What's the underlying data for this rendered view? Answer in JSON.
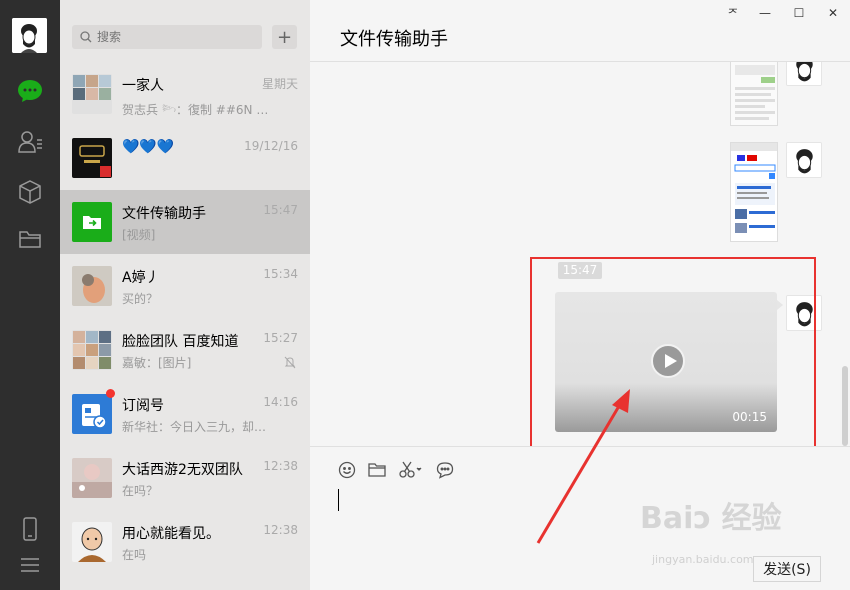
{
  "search": {
    "placeholder": "搜索"
  },
  "add_label": "+",
  "sessions": [
    {
      "name": "一家人",
      "preview": "贺志兵 𓆸：復制 ##6N …",
      "time": "星期天"
    },
    {
      "name": "💙💙💙",
      "preview": "",
      "time": "19/12/16"
    },
    {
      "name": "文件传输助手",
      "preview": "[视频]",
      "time": "15:47"
    },
    {
      "name": "A婷丿",
      "preview": "买的？",
      "time": "15:34"
    },
    {
      "name": "脸脸团队 百度知道",
      "preview": "嘉敏：[图片]",
      "time": "15:27"
    },
    {
      "name": "订阅号",
      "preview": "新华社：今日入三九，却…",
      "time": "14:16"
    },
    {
      "name": "大话西游2无双团队",
      "preview": "在吗？",
      "time": "12:38"
    },
    {
      "name": "用心就能看见。",
      "preview": "在吗",
      "time": "12:38"
    }
  ],
  "chat": {
    "title": "文件传输助手",
    "timestamp": "15:47",
    "video_duration": "00:15"
  },
  "window_buttons": {
    "pin": "ᅎ",
    "minimize": "—",
    "maximize": "☐",
    "close": "✕"
  },
  "send_label": "发送(S)",
  "watermark": {
    "main": "Baiↄ 经验",
    "sub": "jingyan.baidu.com"
  },
  "colors": {
    "nav_bg": "#2e2e2e",
    "active_session": "#c9c8c7",
    "chat_icon_green": "#1aad19",
    "highlight_red": "#e8322f"
  }
}
